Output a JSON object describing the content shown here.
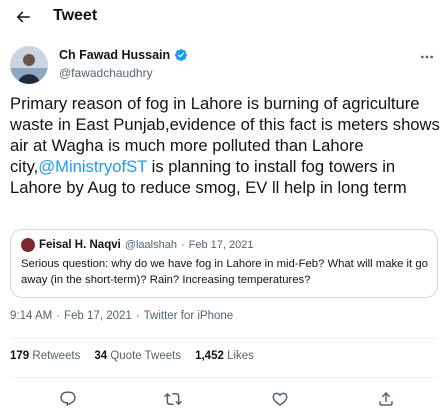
{
  "header": {
    "title": "Tweet",
    "back_icon": "arrow-left-icon"
  },
  "author": {
    "display_name": "Ch Fawad Hussain",
    "handle": "@fawadchaudhry",
    "verified_icon": "verified-badge-icon",
    "verified_color": "#1d9bf0"
  },
  "tweet": {
    "text_before": "Primary reason of fog in Lahore is burning of agriculture waste in East Punjab,evidence of this fact is meters shows air at Wagha is much more polluted than Lahore city,",
    "mention": "@MinistryofST",
    "text_after": " is planning to install fog towers in Lahore by Aug to reduce smog, EV ll help in long term"
  },
  "quote": {
    "name": "Feisal H. Naqvi",
    "handle": "@laalshah",
    "separator": "·",
    "date": "Feb 17, 2021",
    "text": "Serious question: why do we have fog in Lahore in mid-Feb? What will make it go away (in the short-term)? Rain? Increasing temperatures?"
  },
  "meta": {
    "time": "9:14 AM",
    "separator": "·",
    "date": "Feb 17, 2021",
    "source": "Twitter for iPhone"
  },
  "stats": {
    "retweets_count": "179",
    "retweets_label": "Retweets",
    "quotes_count": "34",
    "quotes_label": "Quote Tweets",
    "likes_count": "1,452",
    "likes_label": "Likes"
  },
  "actions": [
    "reply-icon",
    "retweet-icon",
    "like-icon",
    "share-icon"
  ],
  "colors": {
    "accent": "#1d9bf0",
    "secondary_text": "#536471",
    "primary_text": "#0f1419",
    "border": "#cfd9de"
  }
}
